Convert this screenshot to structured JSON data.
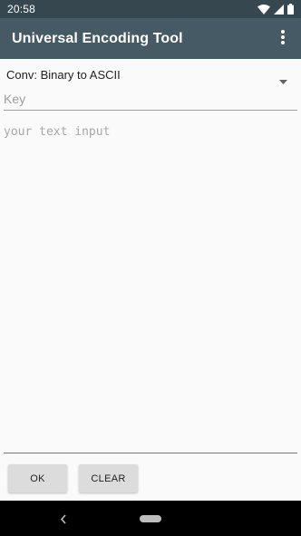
{
  "status_bar": {
    "time": "20:58",
    "icons": [
      "wifi-icon",
      "signal-icon",
      "battery-icon"
    ],
    "background": "#37474f"
  },
  "app_bar": {
    "title": "Universal Encoding Tool",
    "overflow_icon": "more-vert-icon",
    "background": "#455a64"
  },
  "form": {
    "conversion_selected": "Conv: Binary to ASCII",
    "key_placeholder": "Key",
    "key_value": "",
    "text_placeholder": "your text input",
    "text_value": ""
  },
  "buttons": {
    "ok_label": "OK",
    "clear_label": "CLEAR"
  },
  "nav_bar": {
    "icons": [
      "back-icon",
      "home-pill-icon"
    ]
  }
}
